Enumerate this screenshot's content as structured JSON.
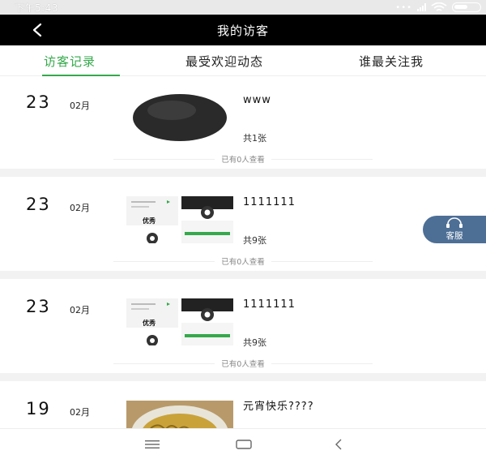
{
  "status_bar": {
    "time": "下午5:43",
    "more_dots": "•••"
  },
  "header": {
    "title": "我的访客",
    "back_icon": "chevron-left-icon"
  },
  "tabs": [
    {
      "label": "访客记录",
      "active": true
    },
    {
      "label": "最受欢迎动态",
      "active": false
    },
    {
      "label": "谁最关注我",
      "active": false
    }
  ],
  "records": [
    {
      "day": "23",
      "month": "02月",
      "title": "www",
      "photo_count": "共1张",
      "views": "已有0人查看",
      "thumb": "dark-circle-image"
    },
    {
      "day": "23",
      "month": "02月",
      "title": "1111111",
      "photo_count": "共9张",
      "views": "已有0人查看",
      "thumb": "screenshot-collage",
      "collage_text": "优秀"
    },
    {
      "day": "23",
      "month": "02月",
      "title": "1111111",
      "photo_count": "共9张",
      "views": "已有0人查看",
      "thumb": "screenshot-collage",
      "collage_text": "优秀"
    },
    {
      "day": "19",
      "month": "02月",
      "title": "元宵快乐????",
      "thumb": "food-bowl-photo"
    }
  ],
  "customer_service": {
    "label": "客服",
    "icon": "headset-icon"
  },
  "nav_bar": {
    "menu_icon": "menu-icon",
    "home_icon": "home-icon",
    "back_icon": "back-icon"
  },
  "colors": {
    "accent": "#35a94b",
    "header_bg": "#000000",
    "cs_button": "#4d6f96"
  }
}
